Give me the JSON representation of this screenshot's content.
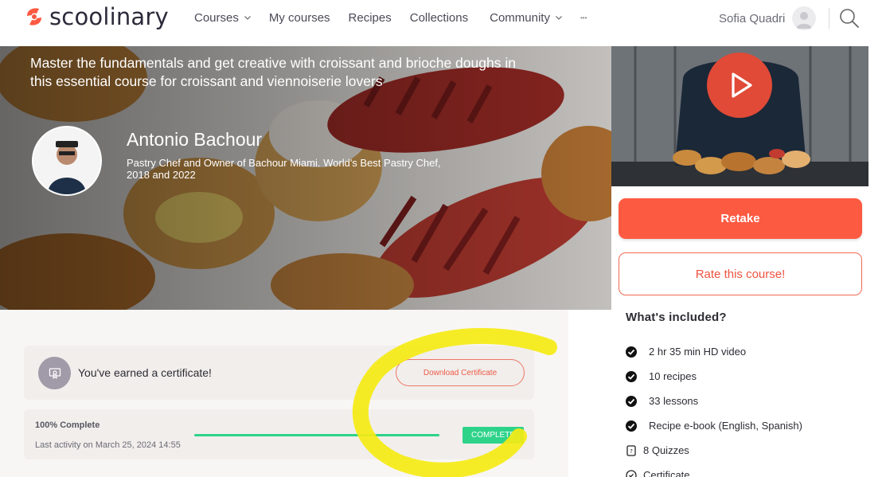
{
  "brand": {
    "name": "scoolinary",
    "logo_icon": "logo-icon",
    "accent": "#fd5a42"
  },
  "nav": {
    "items": [
      {
        "label": "Courses",
        "has_dropdown": true
      },
      {
        "label": "My courses",
        "has_dropdown": false
      },
      {
        "label": "Recipes",
        "has_dropdown": false
      },
      {
        "label": "Collections",
        "has_dropdown": false
      },
      {
        "label": "Community",
        "has_dropdown": true
      }
    ],
    "more_label": "•••"
  },
  "user": {
    "name": "Sofia Quadri",
    "avatar_icon": "user-icon"
  },
  "search_icon": "search-icon",
  "hero": {
    "description": "Master the fundamentals and get creative with croissant and brioche doughs in this essential course for croissant and viennoiserie lovers",
    "instructor": {
      "name": "Antonio Bachour",
      "bio": "Pastry Chef and Owner of Bachour Miami. World's Best Pastry Chef, 2018 and 2022"
    }
  },
  "video": {
    "play_icon": "play-icon"
  },
  "sidebar": {
    "retake_label": "Retake",
    "rate_label": "Rate this course!",
    "included_title": "What's included?",
    "included": [
      {
        "icon": "check-circle-icon",
        "label": "2 hr 35 min HD video"
      },
      {
        "icon": "check-circle-icon",
        "label": "10 recipes"
      },
      {
        "icon": "check-circle-icon",
        "label": "33 lessons"
      },
      {
        "icon": "check-circle-icon",
        "label": "Recipe e-book (English, Spanish)"
      },
      {
        "icon": "quiz-icon",
        "label": "8 Quizzes"
      },
      {
        "icon": "certificate-icon",
        "label": "Certificate"
      }
    ]
  },
  "certificate": {
    "icon": "certificate-icon",
    "message": "You've earned a certificate!",
    "download_label": "Download Certificate"
  },
  "progress": {
    "percent_label": "100% Complete",
    "percent_value": 100,
    "last_activity": "Last activity on March 25, 2024 14:55",
    "badge": "COMPLETE",
    "color": "#2ed38a"
  }
}
